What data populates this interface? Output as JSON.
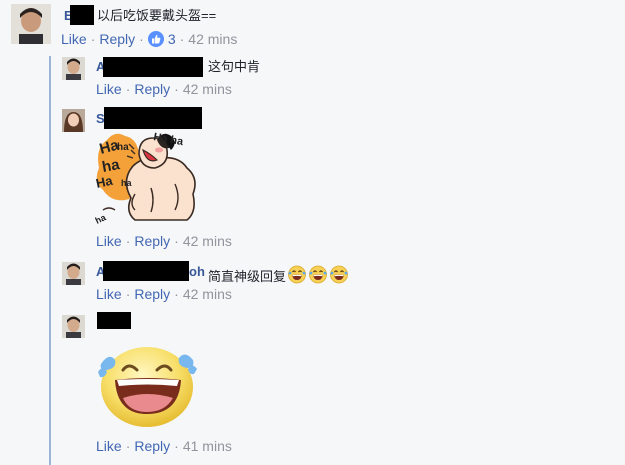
{
  "actions": {
    "like": "Like",
    "reply": "Reply",
    "sep": "·"
  },
  "comments": [
    {
      "name_visible": "E",
      "text": "以后吃饭要戴头盔==",
      "reaction_count": "3",
      "time": "42 mins"
    },
    {
      "name_visible": "A",
      "text": "这句中肯",
      "time": "42 mins"
    },
    {
      "name_visible": "S",
      "sticker": "laughing-sumo-sticker",
      "sticker_text": [
        "Ha",
        "ha",
        "ha",
        "Ha",
        "ha",
        "ha",
        "Ha ha"
      ],
      "time": "42 mins"
    },
    {
      "name_visible_start": "A",
      "name_visible_end": "oh",
      "text": "简直神级回复",
      "emoji": "laughing-tears-emoji",
      "emoji_count": 3,
      "time": "42 mins"
    },
    {
      "sticker": "laughing-face-with-tears-sticker",
      "time": "41 mins"
    }
  ],
  "colors": {
    "link": "#4267b2",
    "name": "#385898",
    "meta": "#90949c",
    "thread_line": "#9cb4d8",
    "background": "#f6f7f9"
  }
}
